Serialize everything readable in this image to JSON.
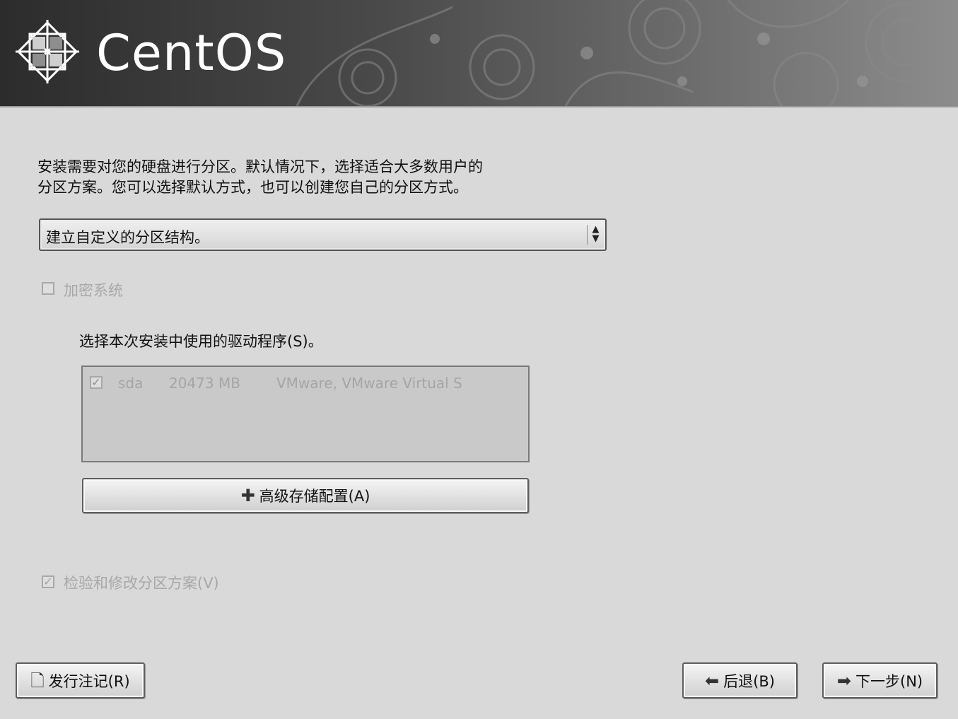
{
  "header": {
    "brand": "CentOS",
    "logo_icon": "centos-logo-icon"
  },
  "intro": {
    "line1": "安装需要对您的硬盘进行分区。默认情况下，选择适合大多数用户的",
    "line2": "分区方案。您可以选择默认方式，也可以创建您自己的分区方式。"
  },
  "partition_layout": {
    "selected": "建立自定义的分区结构。"
  },
  "encrypt": {
    "label": "加密系统",
    "checked": false,
    "enabled": false
  },
  "drives": {
    "label": "选择本次安装中使用的驱动程序(S)。",
    "rows": [
      {
        "checked": true,
        "name": "sda",
        "size": "20473 MB",
        "model": "VMware, VMware Virtual S"
      }
    ]
  },
  "advanced_button": {
    "label": "高级存储配置(A)",
    "icon": "plus-icon"
  },
  "review": {
    "label": "检验和修改分区方案(V)",
    "checked": true,
    "enabled": false
  },
  "footer": {
    "release_notes_label": "发行注记(R)",
    "release_notes_icon": "document-icon",
    "back_label": "后退(B)",
    "back_icon": "left-arrow-icon",
    "next_label": "下一步(N)",
    "next_icon": "right-arrow-icon"
  }
}
